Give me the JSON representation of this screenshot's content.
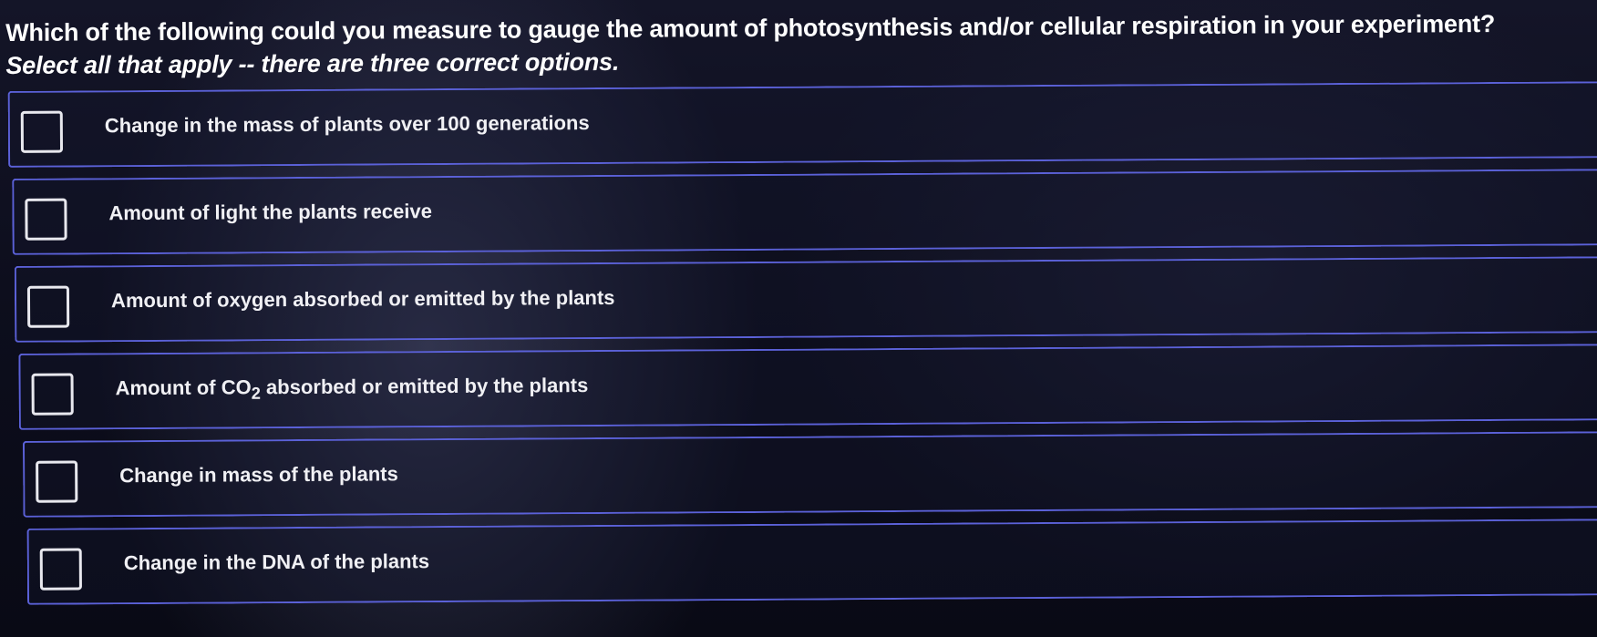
{
  "question": {
    "text": "Which of the following could you measure to gauge the amount of photosynthesis and/or cellular respiration in your experiment?",
    "instruction": "Select all that apply -- there are three correct options."
  },
  "options": [
    {
      "label": "Change in the mass of plants over 100 generations",
      "checked": false
    },
    {
      "label": "Amount of light the plants receive",
      "checked": false
    },
    {
      "label": "Amount of oxygen absorbed or emitted by the plants",
      "checked": false
    },
    {
      "label_prefix": "Amount of CO",
      "label_subscript": "2",
      "label_suffix": " absorbed or emitted by the plants",
      "checked": false
    },
    {
      "label": "Change in mass of the plants",
      "checked": false
    },
    {
      "label": "Change in the DNA of the plants",
      "checked": false
    }
  ],
  "colors": {
    "accent_border": "#5b61d8",
    "checkbox_border": "#e8e8ee",
    "background": "#0b0c18",
    "text": "#f2f2f5"
  }
}
